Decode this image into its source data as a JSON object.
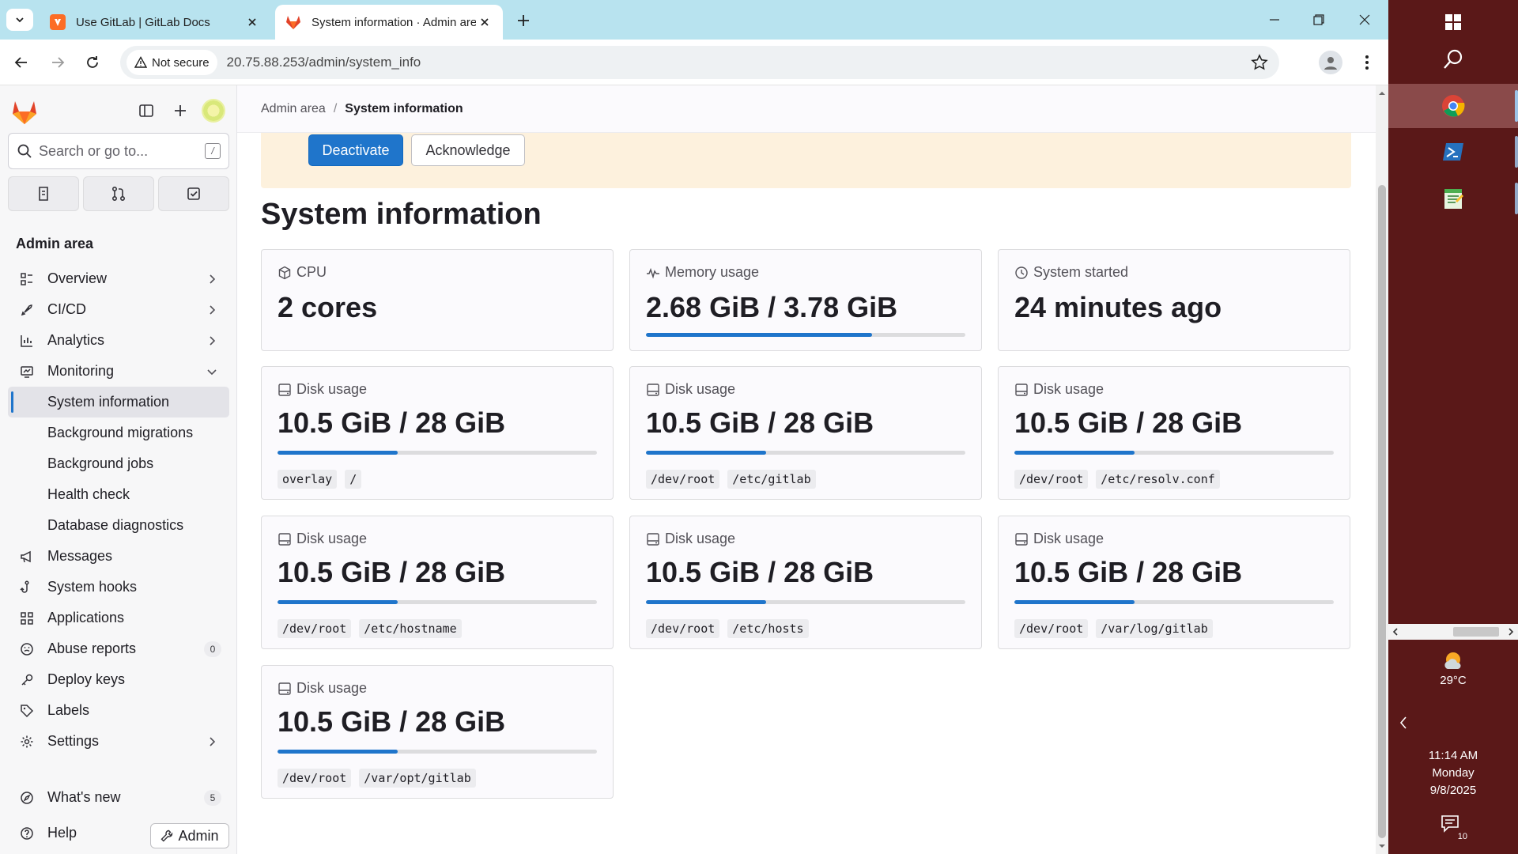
{
  "browser": {
    "tabs": [
      {
        "title": "Use GitLab | GitLab Docs",
        "active": false
      },
      {
        "title": "System information · Admin are",
        "active": true
      }
    ],
    "security_label": "Not secure",
    "url": "20.75.88.253/admin/system_info"
  },
  "sidebar": {
    "search_placeholder": "Search or go to...",
    "slash_key": "/",
    "section_title": "Admin area",
    "nav": [
      {
        "label": "Overview",
        "icon": "overview-icon",
        "chevron": "right"
      },
      {
        "label": "CI/CD",
        "icon": "rocket-icon",
        "chevron": "right"
      },
      {
        "label": "Analytics",
        "icon": "chart-icon",
        "chevron": "right"
      },
      {
        "label": "Monitoring",
        "icon": "monitor-icon",
        "chevron": "down"
      }
    ],
    "monitoring_items": [
      {
        "label": "System information",
        "active": true
      },
      {
        "label": "Background migrations"
      },
      {
        "label": "Background jobs"
      },
      {
        "label": "Health check"
      },
      {
        "label": "Database diagnostics"
      }
    ],
    "nav2": [
      {
        "label": "Messages",
        "icon": "megaphone-icon"
      },
      {
        "label": "System hooks",
        "icon": "hook-icon"
      },
      {
        "label": "Applications",
        "icon": "applications-icon"
      },
      {
        "label": "Abuse reports",
        "icon": "abuse-icon",
        "badge": "0"
      },
      {
        "label": "Deploy keys",
        "icon": "key-icon"
      },
      {
        "label": "Labels",
        "icon": "label-icon"
      },
      {
        "label": "Settings",
        "icon": "gear-icon",
        "chevron": "right"
      }
    ],
    "whats_new": {
      "label": "What's new",
      "badge": "5"
    },
    "help": "Help",
    "admin_button": "Admin"
  },
  "breadcrumb": {
    "root": "Admin area",
    "separator": "/",
    "current": "System information"
  },
  "alert": {
    "primary_button": "Deactivate",
    "secondary_button": "Acknowledge"
  },
  "page_title": "System information",
  "cards": {
    "cpu": {
      "label": "CPU",
      "value": "2 cores"
    },
    "memory": {
      "label": "Memory usage",
      "value": "2.68 GiB / 3.78 GiB",
      "used_fraction": 0.709
    },
    "started": {
      "label": "System started",
      "value": "24 minutes ago"
    },
    "disks": [
      {
        "label": "Disk usage",
        "value": "10.5 GiB / 28 GiB",
        "used_fraction": 0.375,
        "device": "overlay",
        "mount": "/"
      },
      {
        "label": "Disk usage",
        "value": "10.5 GiB / 28 GiB",
        "used_fraction": 0.375,
        "device": "/dev/root",
        "mount": "/etc/gitlab"
      },
      {
        "label": "Disk usage",
        "value": "10.5 GiB / 28 GiB",
        "used_fraction": 0.375,
        "device": "/dev/root",
        "mount": "/etc/resolv.conf"
      },
      {
        "label": "Disk usage",
        "value": "10.5 GiB / 28 GiB",
        "used_fraction": 0.375,
        "device": "/dev/root",
        "mount": "/etc/hostname"
      },
      {
        "label": "Disk usage",
        "value": "10.5 GiB / 28 GiB",
        "used_fraction": 0.375,
        "device": "/dev/root",
        "mount": "/etc/hosts"
      },
      {
        "label": "Disk usage",
        "value": "10.5 GiB / 28 GiB",
        "used_fraction": 0.375,
        "device": "/dev/root",
        "mount": "/var/log/gitlab"
      },
      {
        "label": "Disk usage",
        "value": "10.5 GiB / 28 GiB",
        "used_fraction": 0.375,
        "device": "/dev/root",
        "mount": "/var/opt/gitlab"
      }
    ]
  },
  "taskbar": {
    "temperature": "29°C",
    "time": "11:14 AM",
    "day": "Monday",
    "date": "9/8/2025",
    "notification_count": "10"
  },
  "colors": {
    "accent": "#1f75cb",
    "alert_bg": "#fdf1dd",
    "taskbar_bg": "#5a1818",
    "tabbar_bg": "#b8e3ef"
  }
}
